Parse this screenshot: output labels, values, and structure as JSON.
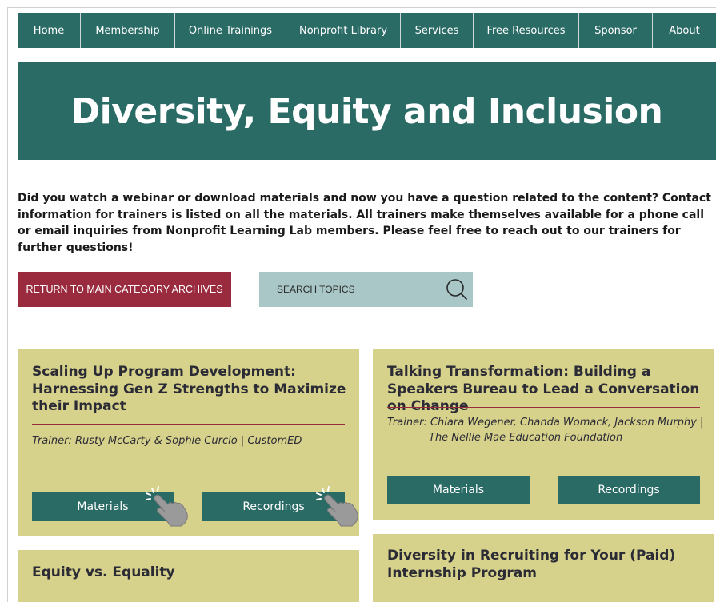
{
  "nav": {
    "items": [
      {
        "label": "Home"
      },
      {
        "label": "Membership"
      },
      {
        "label": "Online Trainings"
      },
      {
        "label": "Nonprofit Library"
      },
      {
        "label": "Services"
      },
      {
        "label": "Free Resources"
      },
      {
        "label": "Sponsor"
      },
      {
        "label": "About"
      }
    ]
  },
  "banner": {
    "title": "Diversity, Equity and Inclusion"
  },
  "intro": "Did you watch a webinar or download materials and now you have a question related to the content? Contact information for trainers is listed on all the materials. All trainers make themselves available for a phone call or email inquiries from Nonprofit Learning Lab members. Please feel free to reach out to our trainers for further questions!",
  "actions": {
    "return_label": "RETURN TO MAIN CATEGORY ARCHIVES",
    "search_placeholder": "SEARCH TOPICS"
  },
  "cards": [
    {
      "title": "Scaling Up Program Development: Harnessing Gen Z Strengths to Maximize their Impact",
      "trainer": "Trainer: Rusty McCarty & Sophie Curcio | CustomED",
      "materials_label": "Materials",
      "recordings_label": "Recordings"
    },
    {
      "title": "Talking Transformation: Building a Speakers Bureau to Lead a Conversation on Change",
      "trainer_line1": "Trainer: Chiara Wegener, Chanda Womack, Jackson Murphy |",
      "trainer_line2": "The Nellie Mae Education Foundation",
      "materials_label": "Materials",
      "recordings_label": "Recordings"
    },
    {
      "title": "Equity vs. Equality"
    },
    {
      "title": "Diversity in Recruiting for Your (Paid) Internship Program"
    }
  ],
  "colors": {
    "teal": "#2b6b66",
    "maroon": "#9a2a3d",
    "card_bg": "#d6d18b",
    "search_bg": "#a9c7c7"
  }
}
